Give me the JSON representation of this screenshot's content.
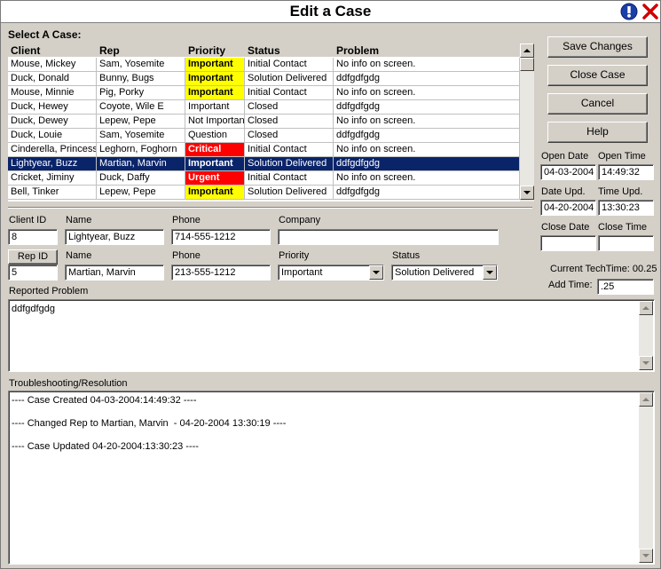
{
  "window": {
    "title": "Edit a Case"
  },
  "grid": {
    "section_label": "Select A Case:",
    "columns": [
      "Client",
      "Rep",
      "Priority",
      "Status",
      "Problem"
    ],
    "rows": [
      {
        "client": "Mouse, Mickey",
        "rep": "Sam, Yosemite",
        "priority": "Important",
        "status": "Initial Contact",
        "problem": "No info on screen."
      },
      {
        "client": "Duck, Donald",
        "rep": "Bunny, Bugs",
        "priority": "Important",
        "status": "Solution Delivered",
        "problem": "ddfgdfgdg"
      },
      {
        "client": "Mouse, Minnie",
        "rep": "Pig, Porky",
        "priority": "Important",
        "status": "Initial Contact",
        "problem": "No info on screen."
      },
      {
        "client": "Duck, Hewey",
        "rep": "Coyote, Wile E",
        "priority": "Important",
        "status": "Closed",
        "problem": "ddfgdfgdg"
      },
      {
        "client": "Duck, Dewey",
        "rep": "Lepew, Pepe",
        "priority": "Not Importan",
        "status": "Closed",
        "problem": "No info on screen."
      },
      {
        "client": "Duck, Louie",
        "rep": "Sam, Yosemite",
        "priority": "Question",
        "status": "Closed",
        "problem": "ddfgdfgdg"
      },
      {
        "client": "Cinderella, Princess",
        "rep": "Leghorn, Foghorn",
        "priority": "Critical",
        "status": "Initial Contact",
        "problem": "No info on screen."
      },
      {
        "client": "Lightyear, Buzz",
        "rep": "Martian, Marvin",
        "priority": "Important",
        "status": "Solution Delivered",
        "problem": "ddfgdfgdg"
      },
      {
        "client": "Cricket, Jiminy",
        "rep": "Duck, Daffy",
        "priority": "Urgent",
        "status": "Initial Contact",
        "problem": "No info on screen."
      },
      {
        "client": "Bell, Tinker",
        "rep": "Lepew, Pepe",
        "priority": "Important",
        "status": "Solution Delivered",
        "problem": "ddfgdfgdg"
      }
    ],
    "row_styles": [
      "yellow",
      "yellow",
      "yellow",
      "plain",
      "plain",
      "plain",
      "red",
      "selected",
      "red",
      "yellow"
    ],
    "selected_index": 7
  },
  "buttons": {
    "save": "Save Changes",
    "close_case": "Close Case",
    "cancel": "Cancel",
    "help": "Help",
    "rep_id": "Rep ID"
  },
  "dates": {
    "open_date_label": "Open Date",
    "open_time_label": "Open Time",
    "open_date": "04-03-2004",
    "open_time": "14:49:32",
    "upd_date_label": "Date Upd.",
    "upd_time_label": "Time Upd.",
    "upd_date": "04-20-2004",
    "upd_time": "13:30:23",
    "close_date_label": "Close Date",
    "close_time_label": "Close Time",
    "close_date": "",
    "close_time": ""
  },
  "tech": {
    "current_label": "Current TechTime: 00.25",
    "add_time_label": "Add Time:",
    "add_time": ".25"
  },
  "client": {
    "id_label": "Client ID",
    "id": "8",
    "name_label": "Name",
    "name": "Lightyear, Buzz",
    "phone_label": "Phone",
    "phone": "714-555-1212",
    "company_label": "Company",
    "company": ""
  },
  "rep": {
    "id": "5",
    "name_label": "Name",
    "name": "Martian, Marvin",
    "phone_label": "Phone",
    "phone": "213-555-1212",
    "priority_label": "Priority",
    "priority": "Important",
    "status_label": "Status",
    "status": "Solution Delivered"
  },
  "problem": {
    "label": "Reported Problem",
    "text": "ddfgdfgdg"
  },
  "resolution": {
    "label": "Troubleshooting/Resolution",
    "lines": [
      "---- Case Created 04-03-2004:14:49:32 ----",
      "---- Changed Rep to Martian, Marvin  - 04-20-2004 13:30:19 ----",
      "---- Case Updated 04-20-2004:13:30:23 ----"
    ]
  },
  "colors": {
    "yellow": "#ffff00",
    "red": "#ff0000",
    "selected": "#0a246a",
    "face": "#d4d0c8"
  },
  "icons": {
    "info": "info-circle-icon",
    "close": "close-x-icon"
  }
}
